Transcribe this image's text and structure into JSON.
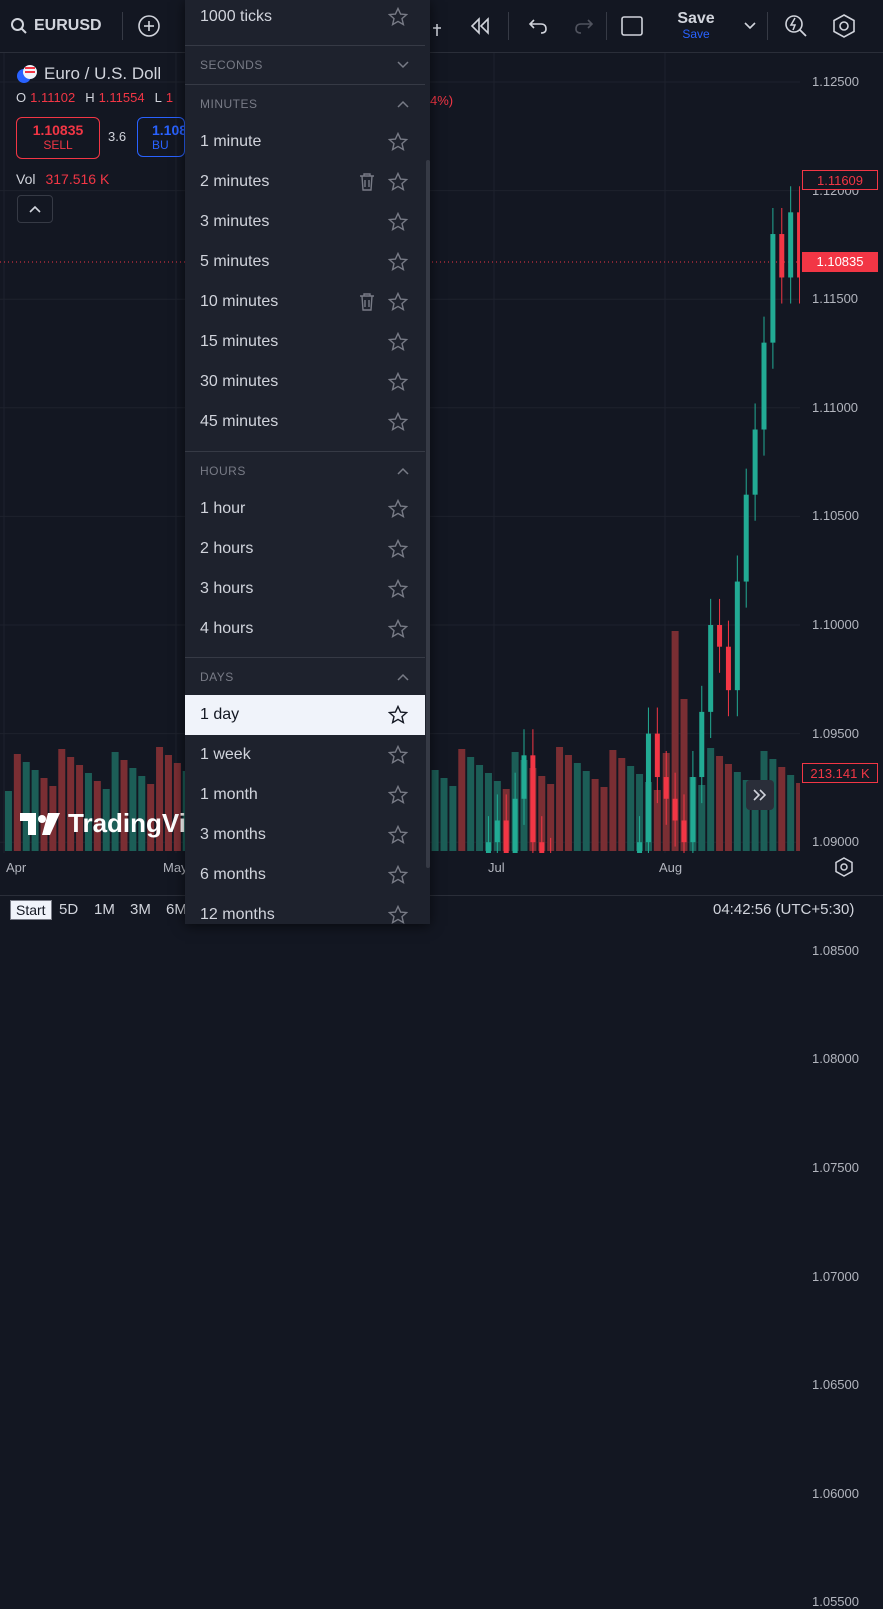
{
  "toolbar": {
    "symbol": "EURUSD",
    "save_label": "Save",
    "save_sub": "Save"
  },
  "legend": {
    "title": "Euro / U.S. Doll",
    "o_label": "O",
    "o_value": "1.11102",
    "h_label": "H",
    "h_value": "1.11554",
    "l_label": "L",
    "l_value": "1",
    "change_tail": "4%)",
    "sell_price": "1.10835",
    "sell_label": "SELL",
    "spread": "3.6",
    "buy_price": "1.108",
    "buy_label": "BU",
    "vol_label": "Vol",
    "vol_value": "317.516 K"
  },
  "yaxis": {
    "labels": [
      "1.12500",
      "1.12000",
      "1.11500",
      "1.11000",
      "1.10500",
      "1.10000",
      "1.09500",
      "1.09000",
      "1.08500",
      "1.08000",
      "1.07500",
      "1.07000",
      "1.06500",
      "1.06000",
      "1.05500"
    ],
    "tag_high": "1.11609",
    "tag_last": "1.10835",
    "tag_vol": "213.141 K"
  },
  "xaxis": {
    "labels": [
      "Apr",
      "May",
      "Jul",
      "Aug"
    ]
  },
  "watermark": "TradingVi",
  "dropdown": {
    "top_item": "1000 ticks",
    "sections": {
      "seconds": "SECONDS",
      "minutes": "MINUTES",
      "hours": "HOURS",
      "days": "DAYS"
    },
    "minutes": [
      "1 minute",
      "2 minutes",
      "3 minutes",
      "5 minutes",
      "10 minutes",
      "15 minutes",
      "30 minutes",
      "45 minutes"
    ],
    "hours": [
      "1 hour",
      "2 hours",
      "3 hours",
      "4 hours"
    ],
    "days": [
      "1 day",
      "1 week",
      "1 month",
      "3 months",
      "6 months",
      "12 months"
    ]
  },
  "bottombar": {
    "start": "Start",
    "ranges": [
      "5D",
      "1M",
      "3M",
      "6M"
    ],
    "time": "04:42:56 (UTC+5:30)"
  },
  "colors": {
    "up": "#22ab94",
    "down": "#f23645",
    "bg": "#131722",
    "menu_bg": "#1e222d",
    "selected_bg": "#f0f3fa"
  }
}
